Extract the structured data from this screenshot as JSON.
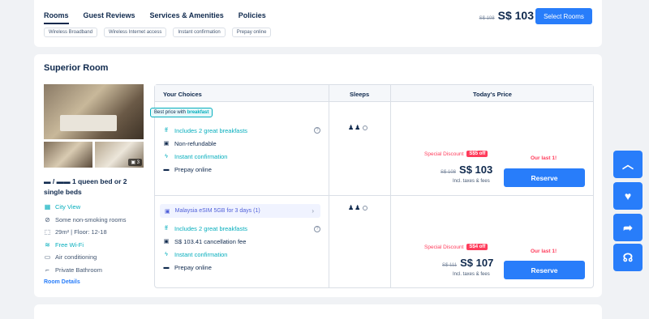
{
  "nav": {
    "tabs": [
      "Rooms",
      "Guest Reviews",
      "Services & Amenities",
      "Policies"
    ],
    "old_price": "S$ 108",
    "price": "S$ 103",
    "select_button": "Select Rooms",
    "chips": [
      "Wireless Broadband",
      "Wireless Internet access",
      "Instant confirmation",
      "Prepay online"
    ]
  },
  "room": {
    "title": "Superior Room",
    "photo_count": "3",
    "bed": "1 queen bed or 2 single beds",
    "amenities": [
      {
        "icon": "window-icon",
        "label": "City View",
        "green": true
      },
      {
        "icon": "no-smoking-icon",
        "label": "Some non-smoking rooms",
        "green": false
      },
      {
        "icon": "area-icon",
        "label": "29m² | Floor: 12-18",
        "green": false
      },
      {
        "icon": "wifi-icon",
        "label": "Free Wi-Fi",
        "green": true
      },
      {
        "icon": "ac-icon",
        "label": "Air conditioning",
        "green": false
      },
      {
        "icon": "bathroom-icon",
        "label": "Private Bathroom",
        "green": false
      }
    ],
    "details_link": "Room Details"
  },
  "table": {
    "headers": [
      "Your Choices",
      "Sleeps",
      "Today's Price"
    ],
    "badge_prefix": "Best price with ",
    "badge_bold": "breakfast",
    "options": [
      {
        "choices": [
          {
            "icon": "breakfast-icon",
            "label": "Includes 2 great breakfasts",
            "green": true
          },
          {
            "icon": "non-refundable-icon",
            "label": "Non-refundable",
            "green": false
          },
          {
            "icon": "lightning-icon",
            "label": "Instant confirmation",
            "green": true
          },
          {
            "icon": "card-icon",
            "label": "Prepay online",
            "green": false
          }
        ],
        "discount_label": "Special Discount",
        "discount_tag": "S$5 off",
        "last_one": "Our last 1!",
        "old_price": "S$ 108",
        "price": "S$ 103",
        "taxes": "Incl. taxes & fees",
        "reserve": "Reserve"
      },
      {
        "esim": "Malaysia eSIM 5GB for 3 days (1)",
        "choices": [
          {
            "icon": "breakfast-icon",
            "label": "Includes 2 great breakfasts",
            "green": true
          },
          {
            "icon": "cancel-fee-icon",
            "label": "S$ 103.41 cancellation fee",
            "green": false
          },
          {
            "icon": "lightning-icon",
            "label": "Instant confirmation",
            "green": true
          },
          {
            "icon": "card-icon",
            "label": "Prepay online",
            "green": false
          }
        ],
        "discount_label": "Special Discount",
        "discount_tag": "S$4 off",
        "last_one": "Our last 1!",
        "old_price": "S$ 111",
        "price": "S$ 107",
        "taxes": "Incl. taxes & fees",
        "reserve": "Reserve"
      }
    ]
  },
  "side_buttons": [
    "back-to-top-icon",
    "favorite-icon",
    "share-icon",
    "support-icon"
  ]
}
